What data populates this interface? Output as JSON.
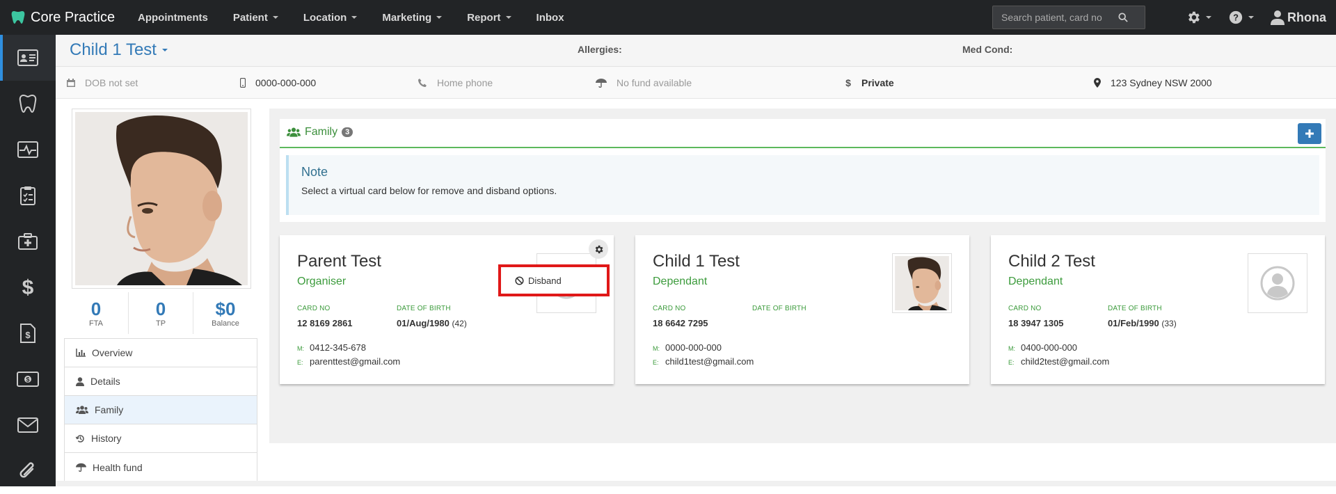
{
  "topbar": {
    "brand": "Core Practice",
    "nav": [
      "Appointments",
      "Patient",
      "Location",
      "Marketing",
      "Report",
      "Inbox"
    ],
    "search_placeholder": "Search patient, card no",
    "user": "Rhona"
  },
  "sidebar": {
    "icons": [
      "id-card-icon",
      "tooth-icon",
      "pulse-icon",
      "clipboard-icon",
      "medkit-icon",
      "dollar-icon",
      "invoice-icon",
      "cash-icon",
      "envelope-icon",
      "paperclip-icon"
    ]
  },
  "patient": {
    "name": "Child 1 Test",
    "allergies_label": "Allergies:",
    "medcond_label": "Med Cond:",
    "dob": "DOB not set",
    "mobile": "0000-000-000",
    "home_phone": "Home phone",
    "fund": "No fund available",
    "billing": "Private",
    "address": "123 Sydney NSW 2000"
  },
  "stats": [
    {
      "value": "0",
      "label": "FTA"
    },
    {
      "value": "0",
      "label": "TP"
    },
    {
      "value": "$0",
      "label": "Balance"
    }
  ],
  "menu": [
    "Overview",
    "Details",
    "Family",
    "History",
    "Health fund"
  ],
  "family": {
    "title": "Family",
    "count": "3",
    "note_title": "Note",
    "note_text": "Select a virtual card below for remove and disband options.",
    "dropdown_label": "Disband",
    "card_no_label": "CARD NO",
    "dob_label": "DATE OF BIRTH",
    "mobile_key": "M:",
    "email_key": "E:",
    "cards": [
      {
        "name": "Parent Test",
        "role": "Organiser",
        "card_no": "12 8169 2861",
        "dob": "01/Aug/1980",
        "age": "(42)",
        "mobile": "0412-345-678",
        "email": "parenttest@gmail.com"
      },
      {
        "name": "Child 1 Test",
        "role": "Dependant",
        "card_no": "18 6642 7295",
        "dob": "",
        "age": "",
        "mobile": "0000-000-000",
        "email": "child1test@gmail.com"
      },
      {
        "name": "Child 2 Test",
        "role": "Dependant",
        "card_no": "18 3947 1305",
        "dob": "01/Feb/1990",
        "age": "(33)",
        "mobile": "0400-000-000",
        "email": "child2test@gmail.com"
      }
    ]
  },
  "colors": {
    "accent": "#337ab7",
    "success": "#3c9b3c",
    "highlight": "#e01818",
    "topbar": "#222426"
  }
}
